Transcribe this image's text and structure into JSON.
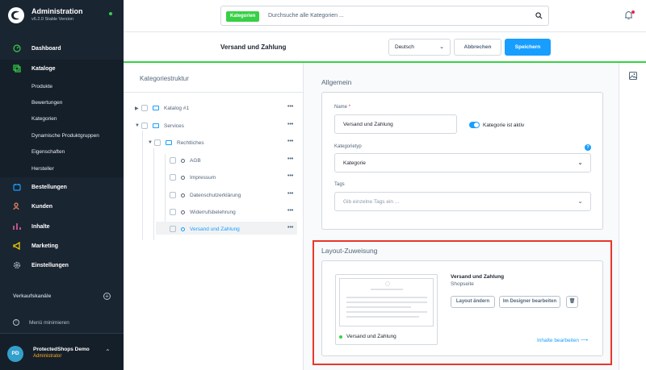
{
  "app": {
    "title": "Administration",
    "version": "v6.2.0 Stable Version"
  },
  "nav": {
    "dashboard": "Dashboard",
    "kataloge": "Kataloge",
    "sub": [
      "Produkte",
      "Bewertungen",
      "Kategorien",
      "Dynamische Produktgruppen",
      "Eigenschaften",
      "Hersteller"
    ],
    "bestellungen": "Bestellungen",
    "kunden": "Kunden",
    "inhalte": "Inhalte",
    "marketing": "Marketing",
    "einstellungen": "Einstellungen",
    "sales_channels": "Verkaufskanäle",
    "minimize": "Menü minimieren"
  },
  "user": {
    "initials": "PD",
    "name": "ProtectedShops Demo",
    "role": "Administrator"
  },
  "search": {
    "tag": "Kategorien",
    "placeholder": "Durchsuche alle Kategorien ..."
  },
  "header": {
    "title": "Versand und Zahlung",
    "language": "Deutsch",
    "cancel": "Abbrechen",
    "save": "Speichern"
  },
  "tree": {
    "title": "Kategoriestruktur",
    "items": [
      "Katalog #1",
      "Services",
      "Rechtliches",
      "AGB",
      "Impressum",
      "Datenschutzerklärung",
      "Widerrufsbelehrung",
      "Versand und Zahlung"
    ],
    "more": "•••"
  },
  "general": {
    "title": "Allgemein",
    "name_label": "Name",
    "required": "*",
    "name_value": "Versand und Zahlung",
    "active_label": "Kategorie ist aktiv",
    "type_label": "Kategorietyp",
    "type_value": "Kategorie",
    "tags_label": "Tags",
    "tags_placeholder": "Gib einzelne Tags ein ..."
  },
  "layout": {
    "title": "Layout-Zuweisung",
    "preview_label": "Versand und Zahlung",
    "name": "Versand und Zahlung",
    "type": "Shopseite",
    "change": "Layout ändern",
    "designer": "Im Designer bearbeiten",
    "edit_content": "Inhalte bearbeiten"
  }
}
